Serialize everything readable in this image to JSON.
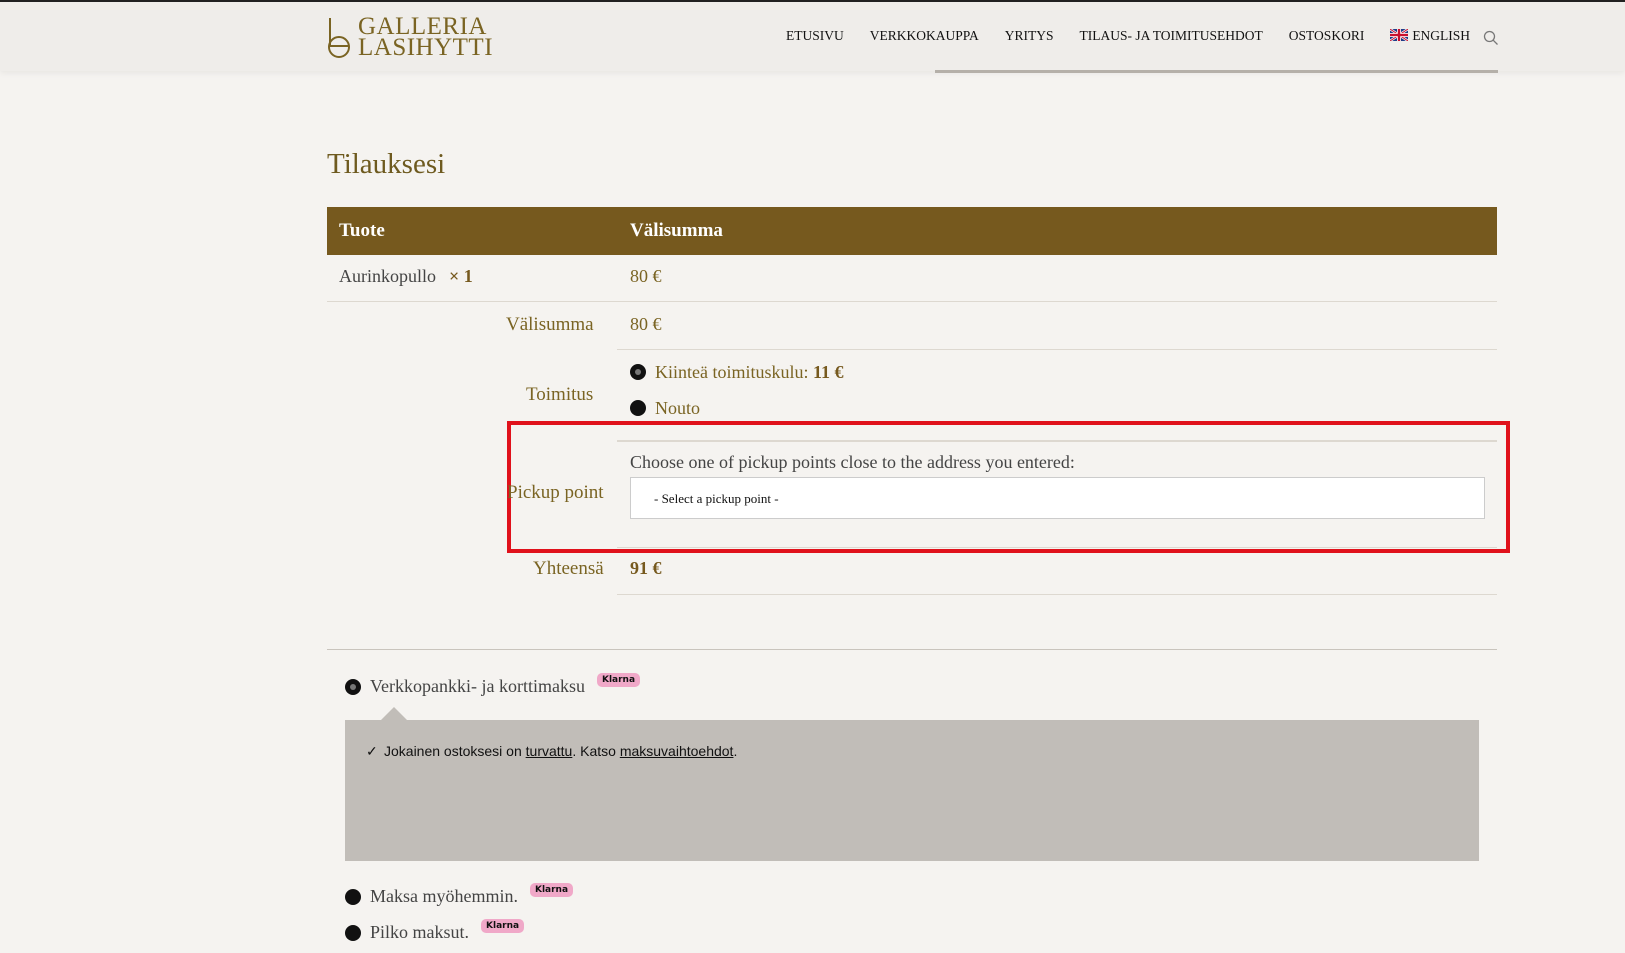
{
  "header": {
    "logo_line1": "GALLERIA",
    "logo_line2": "LASIHYTTI",
    "nav": [
      "ETUSIVU",
      "VERKKOKAUPPA",
      "YRITYS",
      "TILAUS- JA TOIMITUSEHDOT",
      "OSTOSKORI"
    ],
    "language": "ENGLISH",
    "icons": {
      "search": "search-icon",
      "flag": "uk-flag-icon"
    }
  },
  "order": {
    "title": "Tilauksesi",
    "col_product": "Tuote",
    "col_subtotal": "Välisumma",
    "item": {
      "name": "Aurinkopullo",
      "qty": "× 1",
      "price": "80 €"
    },
    "subtotal_label": "Välisumma",
    "subtotal_value": "80 €",
    "shipping_label": "Toimitus",
    "shipping_options": [
      {
        "label": "Kiinteä toimituskulu:",
        "price": "11 €",
        "selected": true
      },
      {
        "label": "Nouto",
        "selected": false
      }
    ],
    "pickup_label": "Pickup point",
    "pickup_text": "Choose one of pickup points close to the address you entered:",
    "pickup_select": "- Select a pickup point -",
    "total_label": "Yhteensä",
    "total_value": "91 €"
  },
  "payment": {
    "options": [
      {
        "label": "Verkkopankki- ja korttimaksu",
        "badge": "Klarna",
        "selected": true
      },
      {
        "label": "Maksa myöhemmin.",
        "badge": "Klarna",
        "selected": false
      },
      {
        "label": "Pilko maksut.",
        "badge": "Klarna",
        "selected": false
      }
    ],
    "note_part1": "Jokainen ostoksesi on ",
    "note_link1": "turvattu",
    "note_part2": ". Katso ",
    "note_link2": "maksuvaihtoehdot",
    "note_part3": ".",
    "klarna_color": "#f0a8c8"
  },
  "colors": {
    "brand": "#76591e",
    "accent_text": "#7a6423",
    "highlight": "#e0111b"
  }
}
